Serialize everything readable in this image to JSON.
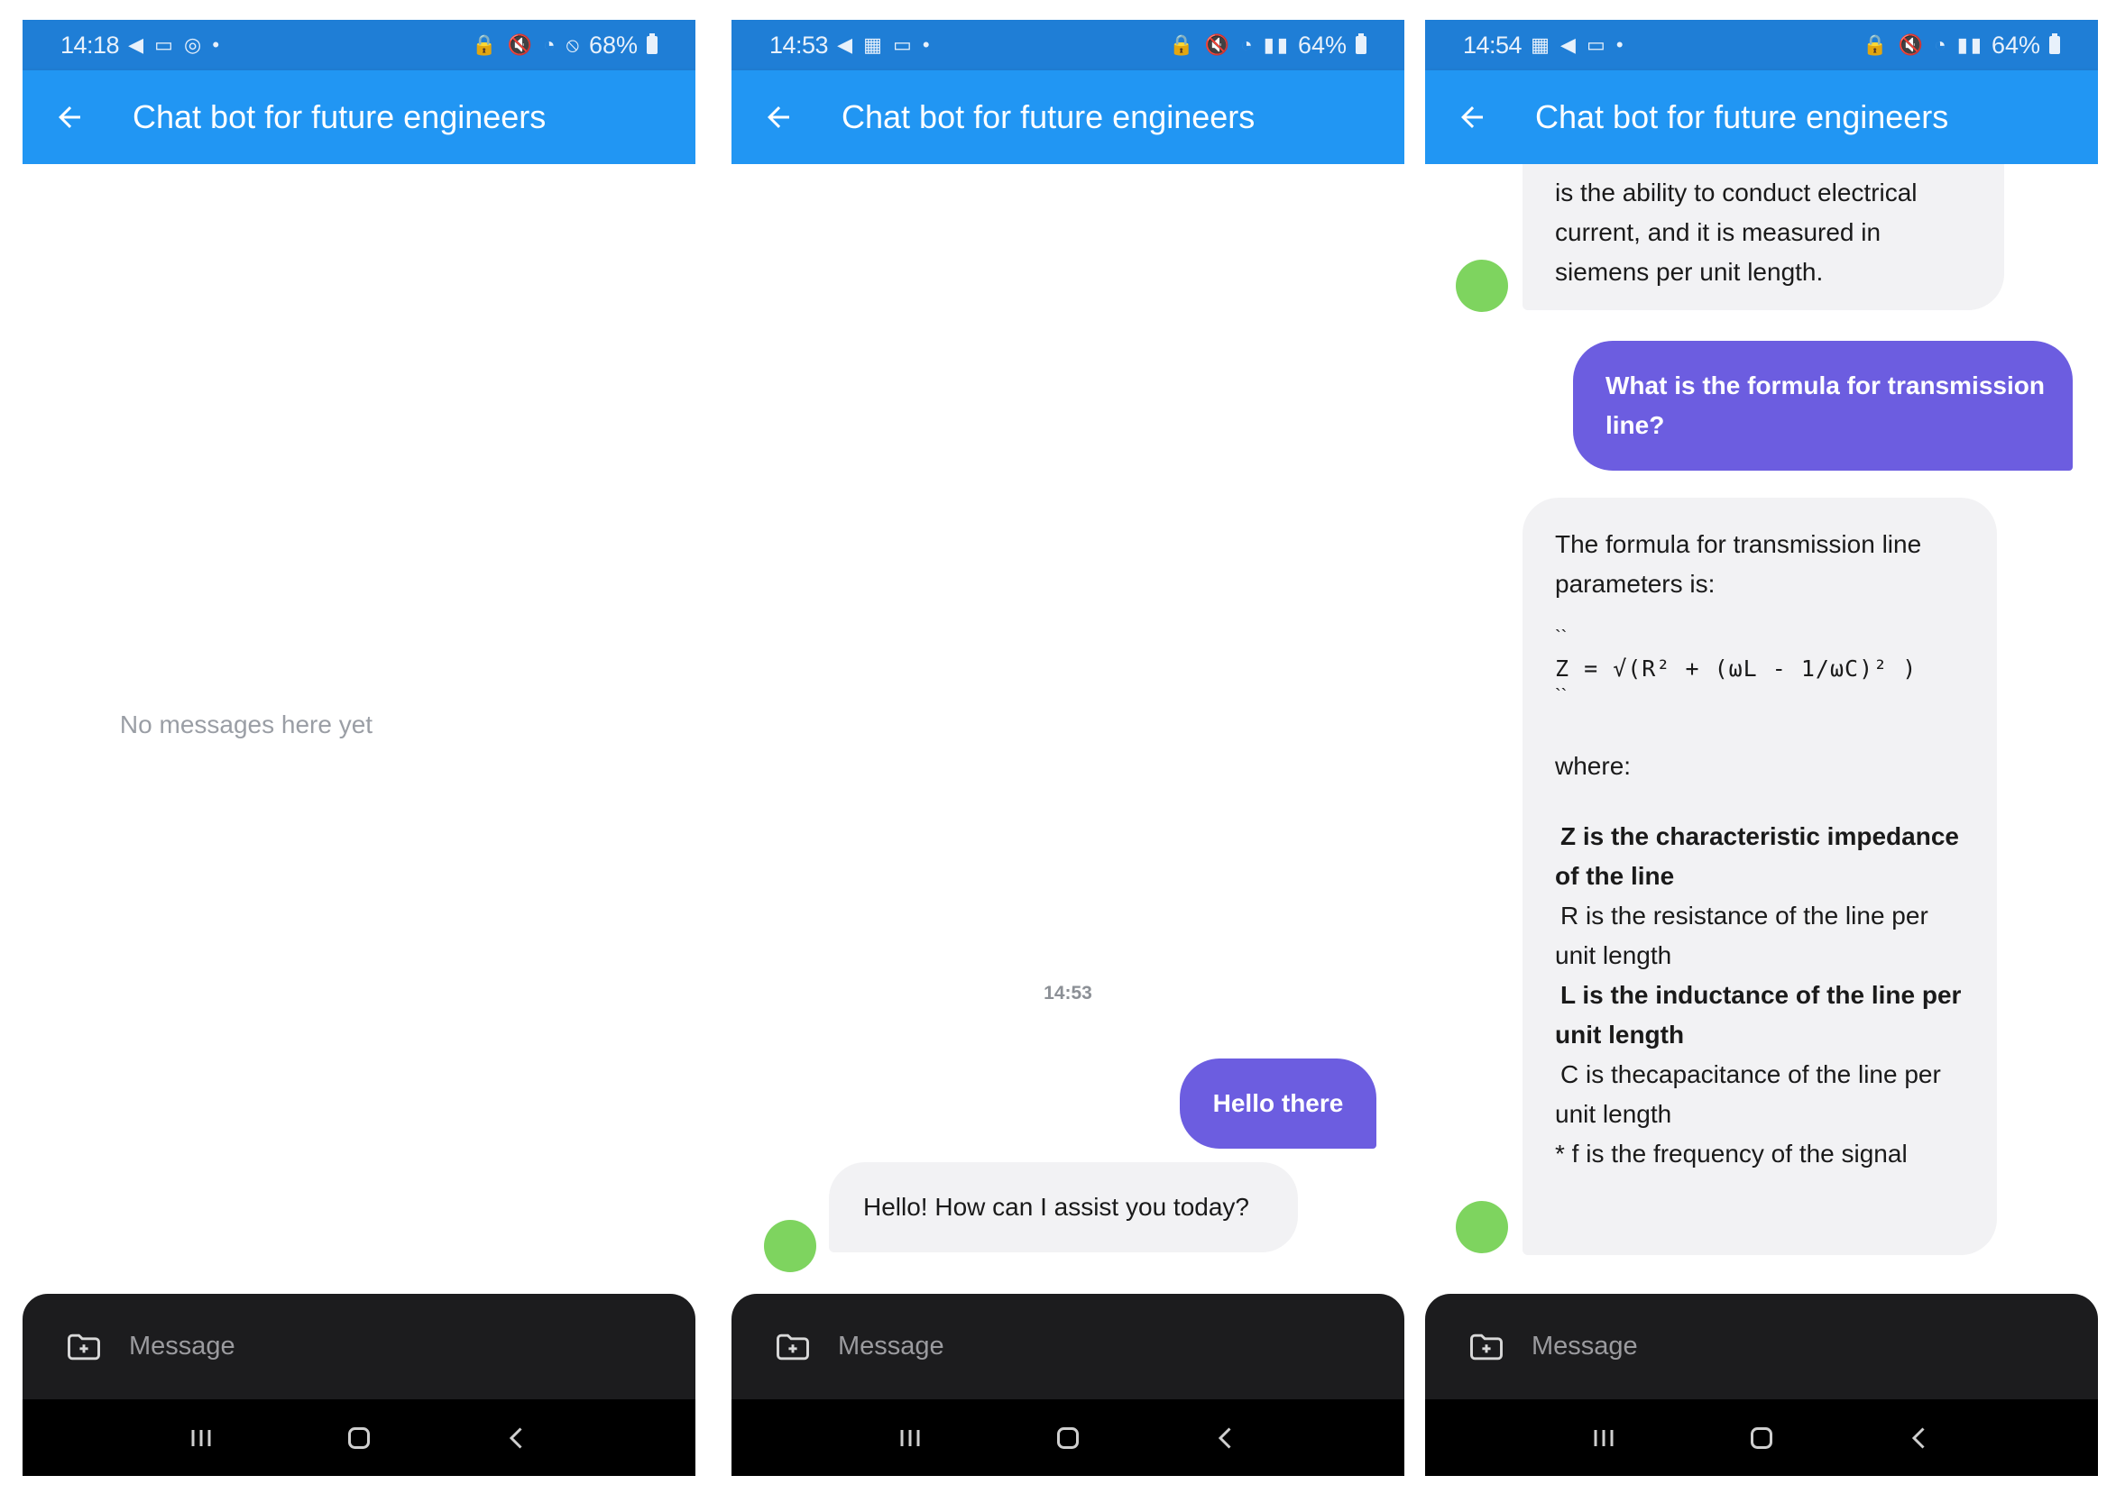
{
  "common": {
    "app_title": "Chat bot for future engineers",
    "message_placeholder": "Message"
  },
  "screens": [
    {
      "status": {
        "time": "14:18",
        "left_icons": "◀ ▭ ◎ •",
        "right_icons": "🔒 🔇 ◔ ⦸",
        "battery": "68%"
      },
      "empty_text": "No messages here yet"
    },
    {
      "status": {
        "time": "14:53",
        "left_icons": "◀ ▦ ▭ •",
        "right_icons": "🔒 🔇 ◔ ▮▮",
        "battery": "64%"
      },
      "timestamp": "14:53",
      "user_message": "Hello there",
      "bot_message": "Hello! How can I assist you today?"
    },
    {
      "status": {
        "time": "14:54",
        "left_icons": "▦ ◀ ▭ •",
        "right_icons": "🔒 🔇 ◔ ▮▮",
        "battery": "64%"
      },
      "bot_message_1": [
        "is the ability to conduct electrical",
        "current, and it is measured in",
        "siemens per unit length."
      ],
      "user_message": [
        "What is the formula for transmission",
        "line?"
      ],
      "bot_message_2": {
        "intro": [
          "The formula for transmission line",
          "parameters is:"
        ],
        "code_open": "``",
        "formula": "Z = √(R² + (ωL - 1/ωC)² )",
        "code_close": "``",
        "where": "where:",
        "items": [
          [
            "Z is the characteristic impedance",
            "of the line"
          ],
          [
            "R is the resistance of the line per",
            "unit length"
          ],
          [
            "L is the inductance of the line per",
            "unit length"
          ],
          [
            "C is thecapacitance of the line per",
            "unit length"
          ],
          [
            "* f is the frequency of the signal"
          ]
        ]
      }
    }
  ]
}
